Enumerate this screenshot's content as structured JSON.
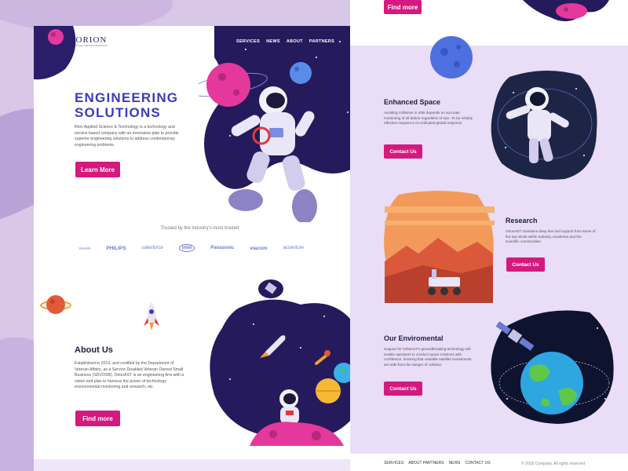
{
  "brand": {
    "logo_text": "ORION",
    "logo_sub": "APPLIED SCIENCE & TECHNOLOGY"
  },
  "nav": {
    "items": [
      "SERVICES",
      "NEWS",
      "ABOUT",
      "PARTNERS"
    ]
  },
  "hero": {
    "title_line1": "ENGINEERING",
    "title_line2": "SOLUTIONS",
    "description": "Rion Applied Science & Technology is a technology and service based company with an innovative plan to provide superior engineering solutions to address contemporary engineering problems.",
    "button_label": "Learn More"
  },
  "trusted": {
    "heading": "Trusted by the industry's most trusted",
    "brands": [
      "RAKIN",
      "PHILIPS",
      "salesforce",
      "intel",
      "Panasonic",
      "viacom",
      "accenture"
    ]
  },
  "about": {
    "title": "About Us",
    "description": "Established in 2013, and certified by the Department of Veteran Affairs, as a Service Disabled Veteran Owned Small Business (SDVOSB), OrionAST is an engineering firm with a vision and plan to harness the power of technology environmental monitoring and research, etc.",
    "button_label": "Find more"
  },
  "right_top": {
    "button_label": "Find more"
  },
  "enhanced": {
    "title": "Enhanced Space",
    "description": "Avoiding collisions in orbit depends on accurate monitoring of all debris regardless of size. To be reliably effective requires a co-ordinated global response",
    "button_label": "Contact Us"
  },
  "research": {
    "title": "Research",
    "description": "OrionAST maintains deep ties and support from some of the top minds within industry, academia and the scientific communities.",
    "button_label": "Contact Us"
  },
  "environmental": {
    "title": "Our Enviromental",
    "description": "Support for OrbitAST's groundbreaking technology will enable operators to conduct space missions with confidence, knowing that valuable satellite investments are safe from the danger of collision.",
    "button_label": "Contact Us"
  },
  "footer": {
    "nav": [
      "SERVICES",
      "ABOUT PARTNERS",
      "NEWS",
      "CONTACT US"
    ],
    "copyright": "© 2018 Company. All rights reserved"
  },
  "colors": {
    "accent": "#d4197f",
    "heading_blue": "#3a3bbd",
    "space_navy": "#241a5c",
    "page_background": "#d9c7e8",
    "right_panel": "#e9ddf7"
  },
  "icons": [
    "astronaut-illustration",
    "rocket-icon",
    "planet-icon",
    "satellite-icon",
    "earth-icon",
    "mars-rover-illustration",
    "ufo-icon"
  ]
}
